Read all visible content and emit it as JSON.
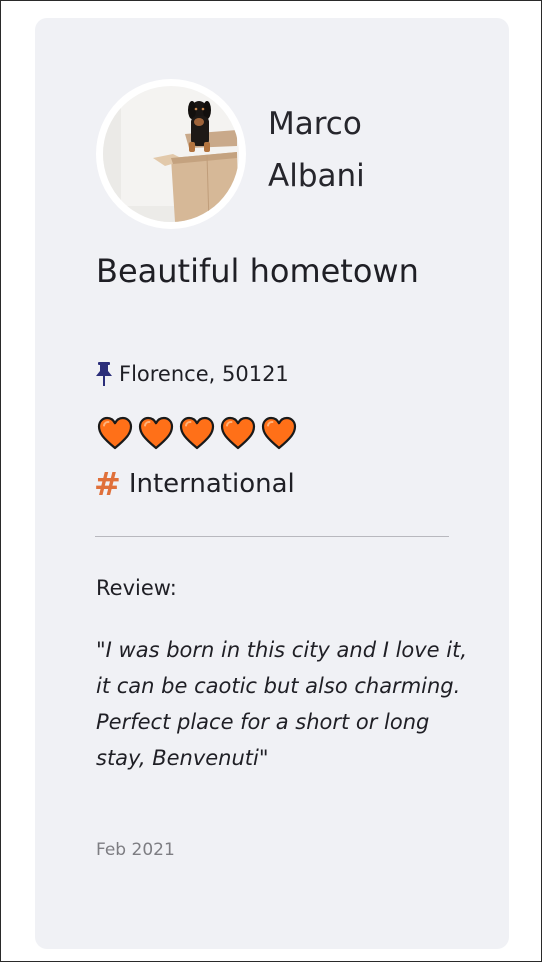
{
  "user": {
    "name_line1": "Marco",
    "name_line2": "Albani",
    "avatar_icon": "dog-in-box-photo"
  },
  "place": {
    "title": "Beautiful hometown",
    "location": "Florence, 50121",
    "location_icon": "pushpin-icon",
    "rating": 5,
    "rating_max": 5,
    "rating_icon": "orange-heart-icon",
    "category": "International",
    "category_icon": "hashtag-icon"
  },
  "review": {
    "label": "Review:",
    "text": "\"I was born in this city and I love it, it can be caotic but also charming. Perfect place for a short or long stay, Benvenuti\"",
    "date": "Feb 2021"
  },
  "colors": {
    "card_background": "#f0f1f5",
    "heart_fill": "#ff7018",
    "hashtag": "#e0703a",
    "pin": "#2b2e7a"
  }
}
